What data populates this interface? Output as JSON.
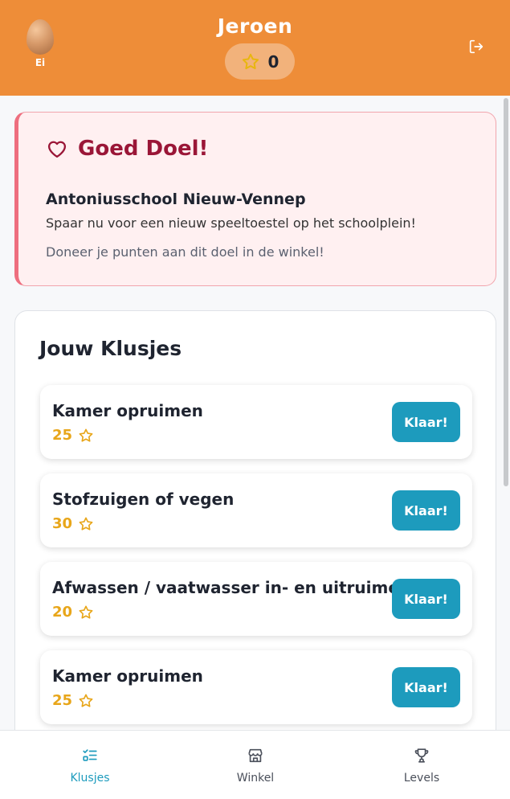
{
  "header": {
    "avatar_label": "Ei",
    "user_name": "Jeroen",
    "points": "0",
    "icons": [
      "egg-avatar",
      "star-icon",
      "logout-icon"
    ]
  },
  "charity": {
    "title": "Goed Doel!",
    "name": "Antoniusschool Nieuw-Vennep",
    "description": "Spaar nu voor een nieuw speeltoestel op het schoolplein!",
    "note": "Doneer je punten aan dit doel in de winkel!",
    "icon": "heart-icon"
  },
  "chores": {
    "title": "Jouw Klusjes",
    "items": [
      {
        "name": "Kamer opruimen",
        "points": "25",
        "button": "Klaar!"
      },
      {
        "name": "Stofzuigen of vegen",
        "points": "30",
        "button": "Klaar!"
      },
      {
        "name": "Afwassen / vaatwasser in- en uitruimen",
        "points": "20",
        "button": "Klaar!"
      },
      {
        "name": "Kamer opruimen",
        "points": "25",
        "button": "Klaar!"
      }
    ]
  },
  "nav": {
    "items": [
      {
        "label": "Klusjes",
        "icon": "list-check-icon",
        "active": true
      },
      {
        "label": "Winkel",
        "icon": "store-icon",
        "active": false
      },
      {
        "label": "Levels",
        "icon": "trophy-icon",
        "active": false
      }
    ]
  },
  "colors": {
    "header": "#ee8d38",
    "accent": "#1d9bbd",
    "points": "#e8a61a",
    "charity_title": "#9a1637",
    "charity_bg": "#fff0f1"
  }
}
